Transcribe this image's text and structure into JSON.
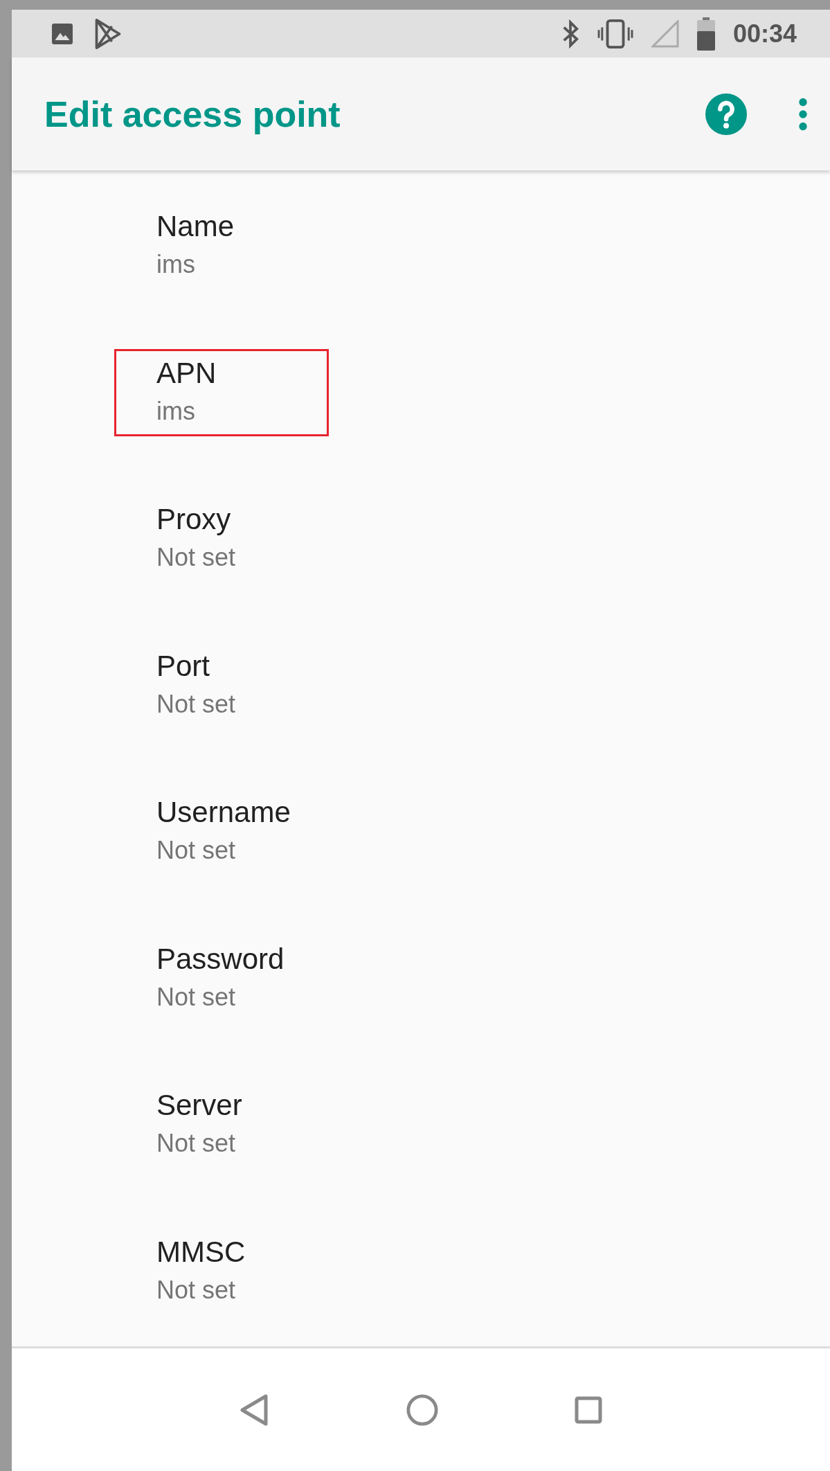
{
  "status_bar": {
    "time": "00:34"
  },
  "app_bar": {
    "title": "Edit access point"
  },
  "settings": [
    {
      "label": "Name",
      "value": "ims",
      "highlighted": false
    },
    {
      "label": "APN",
      "value": "ims",
      "highlighted": true
    },
    {
      "label": "Proxy",
      "value": "Not set",
      "highlighted": false
    },
    {
      "label": "Port",
      "value": "Not set",
      "highlighted": false
    },
    {
      "label": "Username",
      "value": "Not set",
      "highlighted": false
    },
    {
      "label": "Password",
      "value": "Not set",
      "highlighted": false
    },
    {
      "label": "Server",
      "value": "Not set",
      "highlighted": false
    },
    {
      "label": "MMSC",
      "value": "Not set",
      "highlighted": false
    }
  ]
}
